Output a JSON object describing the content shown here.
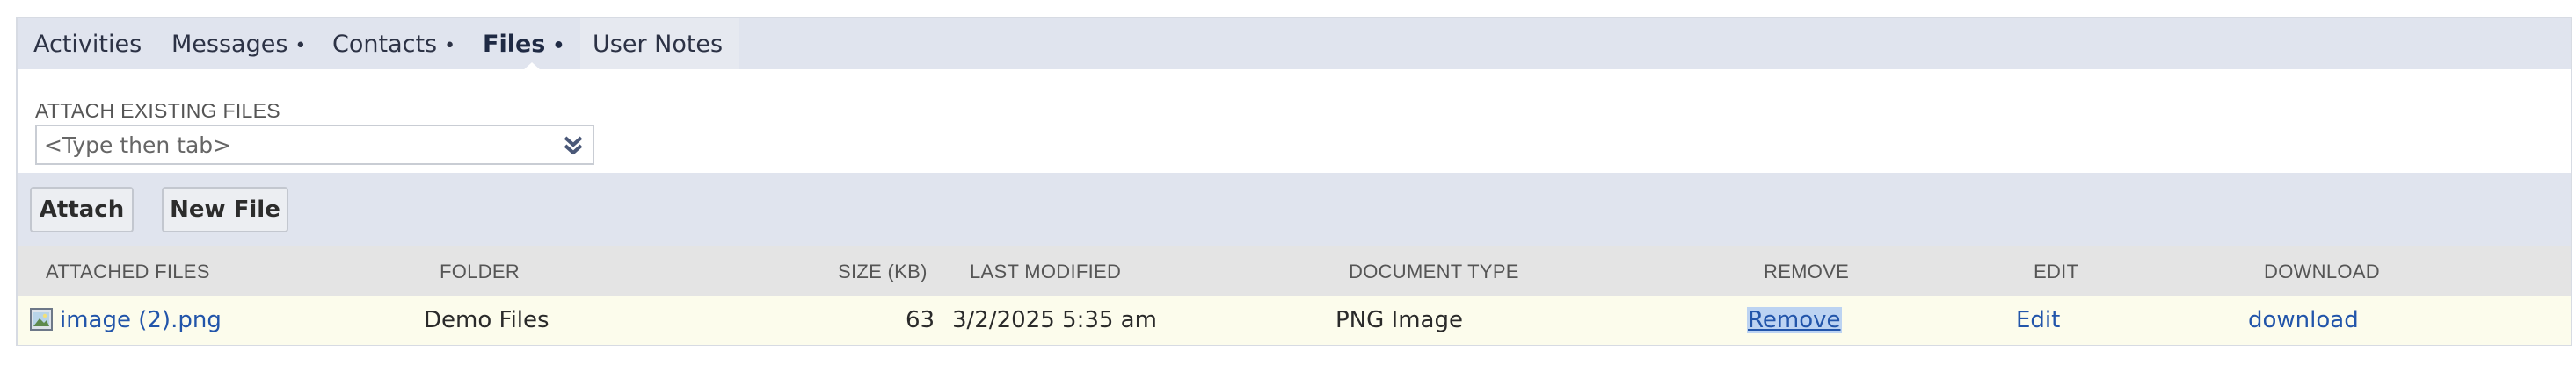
{
  "tabs": [
    {
      "label": "Activities",
      "has_dot": false,
      "active": false
    },
    {
      "label": "Messages",
      "has_dot": true,
      "active": false
    },
    {
      "label": "Contacts",
      "has_dot": true,
      "active": false
    },
    {
      "label": "Files",
      "has_dot": true,
      "active": true
    },
    {
      "label": "User Notes",
      "has_dot": false,
      "active": false
    }
  ],
  "attach": {
    "label": "ATTACH EXISTING FILES",
    "placeholder": "<Type then tab>"
  },
  "buttons": {
    "attach": "Attach",
    "new_file": "New File"
  },
  "table": {
    "columns": [
      "ATTACHED FILES",
      "FOLDER",
      "SIZE (KB)",
      "LAST MODIFIED",
      "DOCUMENT TYPE",
      "REMOVE",
      "EDIT",
      "DOWNLOAD"
    ],
    "rows": [
      {
        "name": "image (2).png",
        "folder": "Demo Files",
        "size": "63",
        "modified": "3/2/2025 5:35 am",
        "doc_type": "PNG Image",
        "remove": "Remove",
        "edit": "Edit",
        "download": "download"
      }
    ]
  },
  "colors": {
    "tab_bar": "#e0e4ee",
    "header_bg": "#e4e4e4",
    "row_bg": "#fcfcec",
    "link": "#2255aa"
  }
}
